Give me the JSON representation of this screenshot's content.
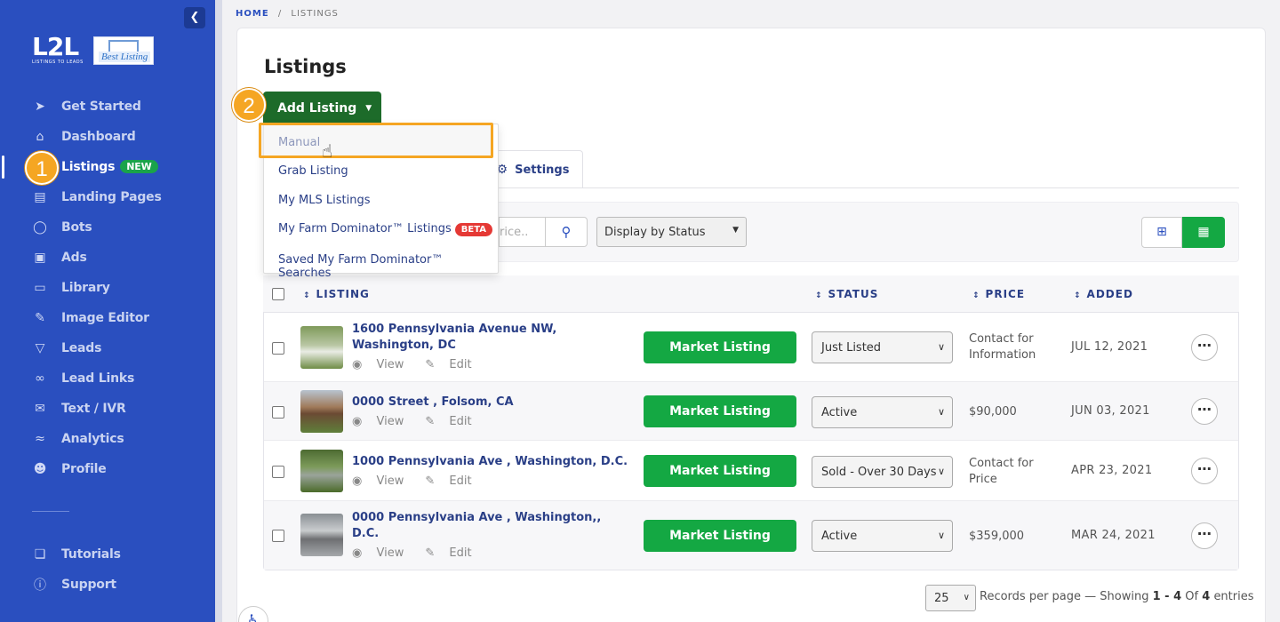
{
  "sidebar": {
    "logo_text": "L2L",
    "logo_sub": "LISTINGS TO LEADS",
    "brand_logo_text": "Best Listing",
    "items": [
      {
        "label": "Get Started",
        "icon": "rocket-icon"
      },
      {
        "label": "Dashboard",
        "icon": "home-icon"
      },
      {
        "label": "Listings",
        "icon": "listings-icon",
        "badge": "NEW",
        "active": true
      },
      {
        "label": "Landing Pages",
        "icon": "browser-icon"
      },
      {
        "label": "Bots",
        "icon": "chat-icon"
      },
      {
        "label": "Ads",
        "icon": "ad-icon"
      },
      {
        "label": "Library",
        "icon": "library-icon"
      },
      {
        "label": "Image Editor",
        "icon": "brush-icon"
      },
      {
        "label": "Leads",
        "icon": "filter-icon"
      },
      {
        "label": "Lead Links",
        "icon": "link-icon"
      },
      {
        "label": "Text / IVR",
        "icon": "message-icon"
      },
      {
        "label": "Analytics",
        "icon": "chart-icon"
      },
      {
        "label": "Profile",
        "icon": "user-icon"
      },
      {
        "label": "Tutorials",
        "icon": "book-icon"
      },
      {
        "label": "Support",
        "icon": "help-icon"
      }
    ]
  },
  "steps": {
    "one": "1",
    "two": "2"
  },
  "breadcrumb": {
    "home": "HOME",
    "sep": "/",
    "current": "LISTINGS"
  },
  "page": {
    "title": "Listings"
  },
  "add_listing": {
    "label": "Add Listing",
    "menu": [
      "Manual",
      "Grab Listing",
      "My MLS Listings",
      "My Farm Dominator™ Listings",
      "Saved My Farm Dominator™ Searches"
    ],
    "beta_badge": "BETA"
  },
  "tabs": {
    "settings": "Settings"
  },
  "filters": {
    "search_placeholder": "rice..",
    "display_by": "Display by Status"
  },
  "table": {
    "headers": {
      "listing": "LISTING",
      "status": "STATUS",
      "price": "PRICE",
      "added": "ADDED"
    },
    "view_label": "View",
    "edit_label": "Edit",
    "market_label": "Market Listing",
    "rows": [
      {
        "address_1": "1600 Pennsylvania Avenue NW,",
        "address_2": "Washington, DC",
        "status": "Just Listed",
        "price_1": "Contact for",
        "price_2": "Information",
        "added": "JUL 12, 2021"
      },
      {
        "address_1": "0000 Street , Folsom, CA",
        "address_2": "",
        "status": "Active",
        "price_1": "$90,000",
        "price_2": "",
        "added": "JUN 03, 2021"
      },
      {
        "address_1": "1000 Pennsylvania Ave , Washington, D.C.",
        "address_2": "",
        "status": "Sold - Over 30 Days",
        "price_1": "Contact for",
        "price_2": "Price",
        "added": "APR 23, 2021"
      },
      {
        "address_1": "0000 Pennsylvania Ave , Washington,,",
        "address_2": "D.C.",
        "status": "Active",
        "price_1": "$359,000",
        "price_2": "",
        "added": "MAR 24, 2021"
      }
    ]
  },
  "pagination": {
    "per_page": "25",
    "records_prefix": "Records per page — Showing",
    "range": "1 - 4",
    "of": "Of",
    "total": "4",
    "entries": "entries"
  },
  "colors": {
    "sidebar": "#2a4fbf",
    "accent_green": "#14a843",
    "dark_green": "#1d6b2a",
    "highlight": "#f5a623",
    "beta": "#e53935"
  }
}
